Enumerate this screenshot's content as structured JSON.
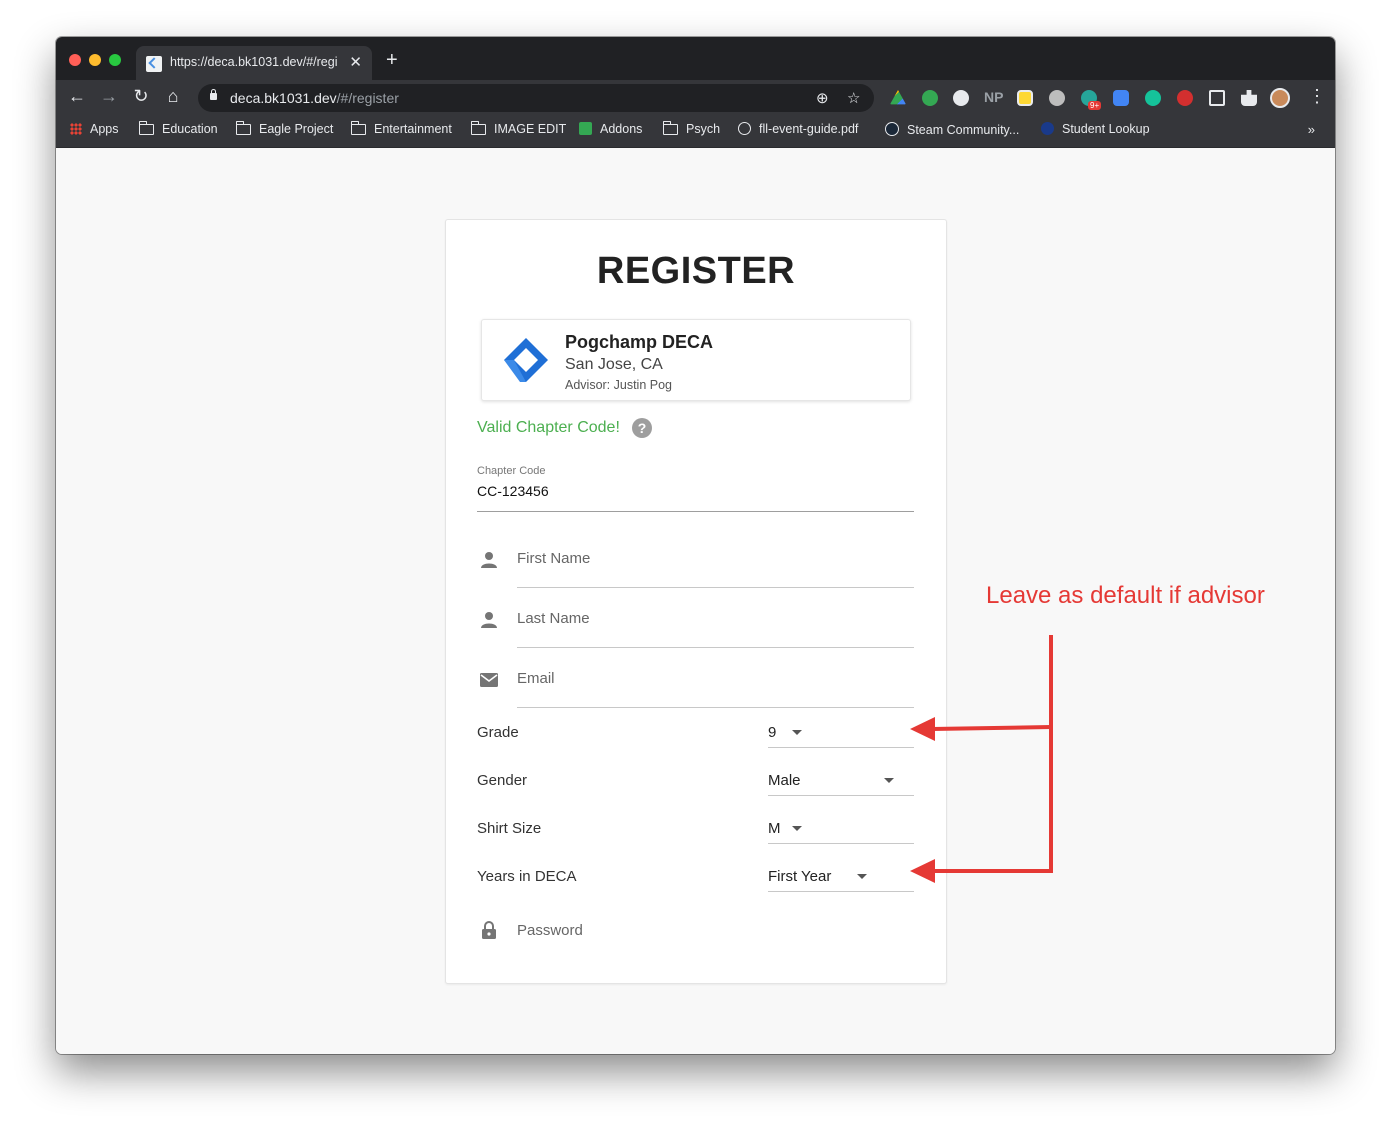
{
  "browser": {
    "tab_title": "https://deca.bk1031.dev/#/regi",
    "url_host": "deca.bk1031.dev",
    "url_path": "/#/register",
    "bookmarks": [
      {
        "label": "Apps",
        "icon": "apps-grid-icon"
      },
      {
        "label": "Education",
        "icon": "folder-icon"
      },
      {
        "label": "Eagle Project",
        "icon": "folder-icon"
      },
      {
        "label": "Entertainment",
        "icon": "folder-icon"
      },
      {
        "label": "IMAGE EDIT",
        "icon": "folder-icon"
      },
      {
        "label": "Addons",
        "icon": "puzzle-icon"
      },
      {
        "label": "Psych",
        "icon": "folder-icon"
      },
      {
        "label": "fll-event-guide.pdf",
        "icon": "globe-icon"
      },
      {
        "label": "Steam Community...",
        "icon": "steam-icon"
      },
      {
        "label": "Student Lookup",
        "icon": "lookup-icon"
      }
    ],
    "ext_np_label": "NP",
    "ext_badge": "9+",
    "overflow_label": "»"
  },
  "form": {
    "title": "REGISTER",
    "chapter": {
      "name": "Pogchamp DECA",
      "location": "San Jose, CA",
      "advisor": "Advisor: Justin Pog"
    },
    "valid_message": "Valid Chapter Code!",
    "help_glyph": "?",
    "chapter_code_label": "Chapter Code",
    "chapter_code_value": "CC-123456",
    "first_name_placeholder": "First Name",
    "last_name_placeholder": "Last Name",
    "email_placeholder": "Email",
    "password_placeholder": "Password",
    "selects": {
      "grade": {
        "label": "Grade",
        "value": "9"
      },
      "gender": {
        "label": "Gender",
        "value": "Male"
      },
      "shirt_size": {
        "label": "Shirt Size",
        "value": "M"
      },
      "years": {
        "label": "Years in DECA",
        "value": "First Year"
      }
    }
  },
  "annotation": {
    "text": "Leave as default if advisor",
    "color": "#e53935"
  },
  "colors": {
    "valid_green": "#4caf50",
    "deca_blue": "#1f6fd6"
  }
}
